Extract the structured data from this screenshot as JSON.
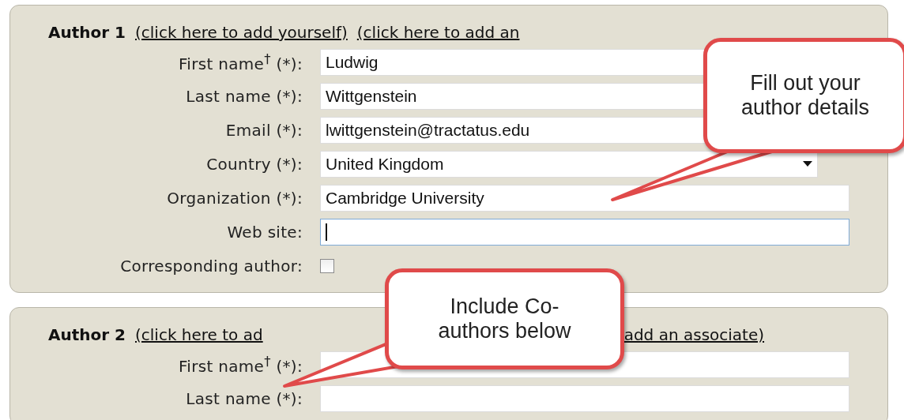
{
  "authors": [
    {
      "title": "Author 1",
      "links": [
        "(click here to add yourself)",
        "(click here to add an"
      ],
      "fields": [
        {
          "kind": "text",
          "label": "First name$^{†}$ (*):",
          "value": "Ludwig",
          "focused": false
        },
        {
          "kind": "text",
          "label": "Last name (*):",
          "value": "Wittgenstein",
          "focused": false
        },
        {
          "kind": "text",
          "label": "Email (*):",
          "value": "lwittgenstein@tractatus.edu",
          "focused": false
        },
        {
          "kind": "select",
          "label": "Country (*):",
          "value": "United Kingdom",
          "focused": false
        },
        {
          "kind": "text",
          "label": "Organization (*):",
          "value": "Cambridge University",
          "focused": false
        },
        {
          "kind": "text",
          "label": "Web site:",
          "focused": true
        },
        {
          "kind": "checkbox",
          "label": "Corresponding author:",
          "checked": false
        }
      ]
    },
    {
      "title": "Author 2",
      "links": [
        "(click here to ad",
        "add an associate)"
      ],
      "fields": [
        {
          "kind": "text",
          "label": "First name$^{†}$ (*):",
          "focused": false
        },
        {
          "kind": "text",
          "label": "Last name (*):",
          "focused": false
        }
      ]
    }
  ],
  "callouts": [
    {
      "text": "Fill out your author details"
    },
    {
      "text": "Include Co-authors below"
    }
  ]
}
